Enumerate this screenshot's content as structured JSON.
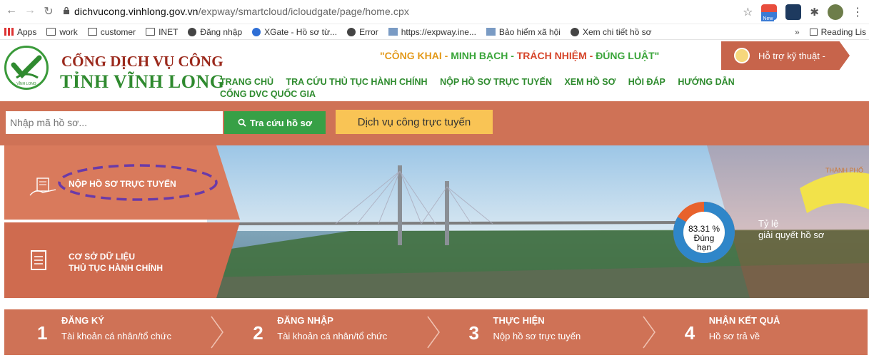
{
  "browser": {
    "url_host": "dichvucong.vinhlong.gov.vn",
    "url_path": "/expway/smartcloud/icloudgate/page/home.cpx",
    "ext_new_badge": "New",
    "bookmarks": [
      {
        "label": "Apps",
        "icon": "apps-grid-icon"
      },
      {
        "label": "work",
        "icon": "folder-icon"
      },
      {
        "label": "customer",
        "icon": "folder-icon"
      },
      {
        "label": "INET",
        "icon": "folder-icon"
      },
      {
        "label": "Đăng nhập",
        "icon": "globe-icon"
      },
      {
        "label": "XGate - Hồ sơ từ...",
        "icon": "xgate-icon"
      },
      {
        "label": "Error",
        "icon": "globe-icon"
      },
      {
        "label": "https://expway.ine...",
        "icon": "site-icon"
      },
      {
        "label": "Bảo hiểm xã hội",
        "icon": "site-icon"
      },
      {
        "label": "Xem chi tiết hồ sơ",
        "icon": "globe-icon"
      }
    ],
    "more_bookmarks": "»",
    "reading_list": "Reading Lis"
  },
  "header": {
    "title_line1": "CỔNG DỊCH VỤ CÔNG",
    "title_line2": "TỈNH VĨNH LONG",
    "logo_caption": "VĨNH LONG",
    "slogan_parts": [
      {
        "text": "\"CÔNG KHAI - ",
        "color": "#e39a1c"
      },
      {
        "text": "MINH BẠCH - ",
        "color": "#3aa53a"
      },
      {
        "text": "TRÁCH NHIỆM - ",
        "color": "#d6452a"
      },
      {
        "text": "ĐÚNG LUẬT\"",
        "color": "#3aa53a"
      }
    ],
    "support_label": "Hỗ trợ kỹ thuật  -",
    "menu_row1": [
      "TRANG CHỦ",
      "TRA CỨU THỦ TỤC HÀNH CHÍNH",
      "NỘP HỒ SƠ TRỰC TUYẾN",
      "XEM HỒ SƠ",
      "HỎI ĐÁP",
      "HƯỚNG DẪN"
    ],
    "menu_row2": [
      "CỔNG DVC QUỐC GIA"
    ]
  },
  "search": {
    "placeholder": "Nhập mã hồ sơ...",
    "button_label": "Tra cứu hồ sơ",
    "dvc_button": "Dịch vụ công trực tuyến"
  },
  "hero": {
    "tile1_label": "NỘP HỒ SƠ TRỰC TUYẾN",
    "tile2_line1": "CƠ SỞ DỮ LIỆU",
    "tile2_line2": "THỦ TỤC HÀNH CHÍNH",
    "stat_percent": "83.31 %",
    "stat_sub": "Đúng hạn",
    "stat_fraction": 0.8331,
    "ratio_line1": "Tỷ lệ",
    "ratio_line2": "giải quyết hồ sơ",
    "city_sign": "THÀNH PHỐ"
  },
  "steps": [
    {
      "num": "1",
      "title": "ĐĂNG KÝ",
      "desc": "Tài khoản cá nhân/tổ chức"
    },
    {
      "num": "2",
      "title": "ĐĂNG NHẬP",
      "desc": "Tài khoản cá nhân/tổ chức"
    },
    {
      "num": "3",
      "title": "THỰC HIỆN",
      "desc": "Nộp hồ sơ trực tuyến"
    },
    {
      "num": "4",
      "title": "NHẬN KẾT QUẢ",
      "desc": "Hồ sơ trả về"
    }
  ],
  "colors": {
    "brand_orange": "#cf7256",
    "brand_green": "#2e8b2e",
    "button_green": "#37a046",
    "button_yellow": "#f9c455",
    "stat_blue": "#2f86c9",
    "stat_orange": "#e8622c",
    "highlight_ellipse": "#6a3aa8"
  }
}
